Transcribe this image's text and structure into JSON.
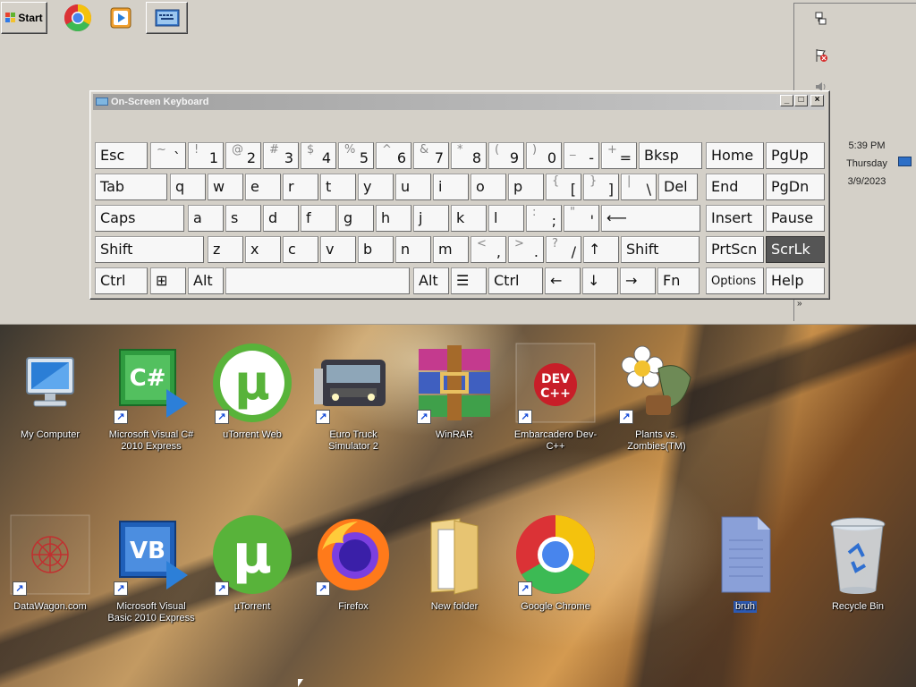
{
  "taskbar": {
    "start_label": "Start",
    "quick_launch": [
      {
        "name": "chrome-icon"
      },
      {
        "name": "media-player-icon"
      },
      {
        "name": "on-screen-keyboard-icon"
      }
    ],
    "tray_icons": [
      "network-icon",
      "flag-icon",
      "volume-icon"
    ],
    "clock": {
      "time": "5:39 PM",
      "day": "Thursday",
      "date": "3/9/2023"
    },
    "expand_glyph": "»"
  },
  "osk": {
    "title": "On-Screen Keyboard",
    "controls": {
      "minimize": "_",
      "restore": "□",
      "close": "×"
    },
    "rows": [
      [
        {
          "label": "Esc"
        },
        {
          "shift": "~",
          "primary": "`"
        },
        {
          "shift": "!",
          "primary": "1"
        },
        {
          "shift": "@",
          "primary": "2"
        },
        {
          "shift": "#",
          "primary": "3"
        },
        {
          "shift": "$",
          "primary": "4"
        },
        {
          "shift": "%",
          "primary": "5"
        },
        {
          "shift": "^",
          "primary": "6"
        },
        {
          "shift": "&",
          "primary": "7"
        },
        {
          "shift": "*",
          "primary": "8"
        },
        {
          "shift": "(",
          "primary": "9"
        },
        {
          "shift": ")",
          "primary": "0"
        },
        {
          "shift": "_",
          "primary": "-"
        },
        {
          "shift": "+",
          "primary": "="
        },
        {
          "label": "Bksp"
        },
        {
          "label": "Home"
        },
        {
          "label": "PgUp"
        }
      ],
      [
        {
          "label": "Tab"
        },
        {
          "label": "q"
        },
        {
          "label": "w"
        },
        {
          "label": "e"
        },
        {
          "label": "r"
        },
        {
          "label": "t"
        },
        {
          "label": "y"
        },
        {
          "label": "u"
        },
        {
          "label": "i"
        },
        {
          "label": "o"
        },
        {
          "label": "p"
        },
        {
          "shift": "{",
          "primary": "["
        },
        {
          "shift": "}",
          "primary": "]"
        },
        {
          "shift": "|",
          "primary": "\\"
        },
        {
          "label": "Del"
        },
        {
          "label": "End"
        },
        {
          "label": "PgDn"
        }
      ],
      [
        {
          "label": "Caps"
        },
        {
          "label": "a"
        },
        {
          "label": "s"
        },
        {
          "label": "d"
        },
        {
          "label": "f"
        },
        {
          "label": "g"
        },
        {
          "label": "h"
        },
        {
          "label": "j"
        },
        {
          "label": "k"
        },
        {
          "label": "l"
        },
        {
          "shift": ":",
          "primary": ";"
        },
        {
          "shift": "\"",
          "primary": "'"
        },
        {
          "label": "⟵"
        },
        {
          "label": "Insert"
        },
        {
          "label": "Pause"
        }
      ],
      [
        {
          "label": "Shift"
        },
        {
          "label": "z"
        },
        {
          "label": "x"
        },
        {
          "label": "c"
        },
        {
          "label": "v"
        },
        {
          "label": "b"
        },
        {
          "label": "n"
        },
        {
          "label": "m"
        },
        {
          "shift": "<",
          "primary": ","
        },
        {
          "shift": ">",
          "primary": "."
        },
        {
          "shift": "?",
          "primary": "/"
        },
        {
          "label": "↑"
        },
        {
          "label": "Shift"
        },
        {
          "label": "PrtScn"
        },
        {
          "label": "ScrLk",
          "active": true
        }
      ],
      [
        {
          "label": "Ctrl"
        },
        {
          "label": "⊞"
        },
        {
          "label": "Alt"
        },
        {
          "label": ""
        },
        {
          "label": "Alt"
        },
        {
          "label": "☰"
        },
        {
          "label": "Ctrl"
        },
        {
          "label": "←"
        },
        {
          "label": "↓"
        },
        {
          "label": "→"
        },
        {
          "label": "Fn"
        },
        {
          "label": "Options"
        },
        {
          "label": "Help"
        }
      ]
    ]
  },
  "desktop": {
    "icons": [
      {
        "name": "my-computer",
        "label": "My Computer",
        "shortcut": false
      },
      {
        "name": "visual-csharp",
        "label": "Microsoft Visual C# 2010 Express",
        "shortcut": true
      },
      {
        "name": "utorrent-web",
        "label": "uTorrent Web",
        "shortcut": true
      },
      {
        "name": "euro-truck",
        "label": "Euro Truck Simulator 2",
        "shortcut": true
      },
      {
        "name": "winrar",
        "label": "WinRAR",
        "shortcut": true
      },
      {
        "name": "dev-cpp",
        "label": "Embarcadero Dev-C++",
        "shortcut": true
      },
      {
        "name": "plants-vs-zombies",
        "label": "Plants vs. Zombies(TM)",
        "shortcut": true
      },
      {
        "name": "datawagon",
        "label": "DataWagon.com",
        "shortcut": true
      },
      {
        "name": "visual-basic",
        "label": "Microsoft Visual Basic 2010 Express",
        "shortcut": true
      },
      {
        "name": "utorrent",
        "label": "µTorrent",
        "shortcut": true
      },
      {
        "name": "firefox",
        "label": "Firefox",
        "shortcut": true
      },
      {
        "name": "new-folder",
        "label": "New folder",
        "shortcut": false
      },
      {
        "name": "google-chrome",
        "label": "Google Chrome",
        "shortcut": true
      },
      {
        "name": "bruh",
        "label": "bruh",
        "shortcut": false,
        "selected": true
      },
      {
        "name": "recycle-bin",
        "label": "Recycle Bin",
        "shortcut": false
      }
    ]
  }
}
